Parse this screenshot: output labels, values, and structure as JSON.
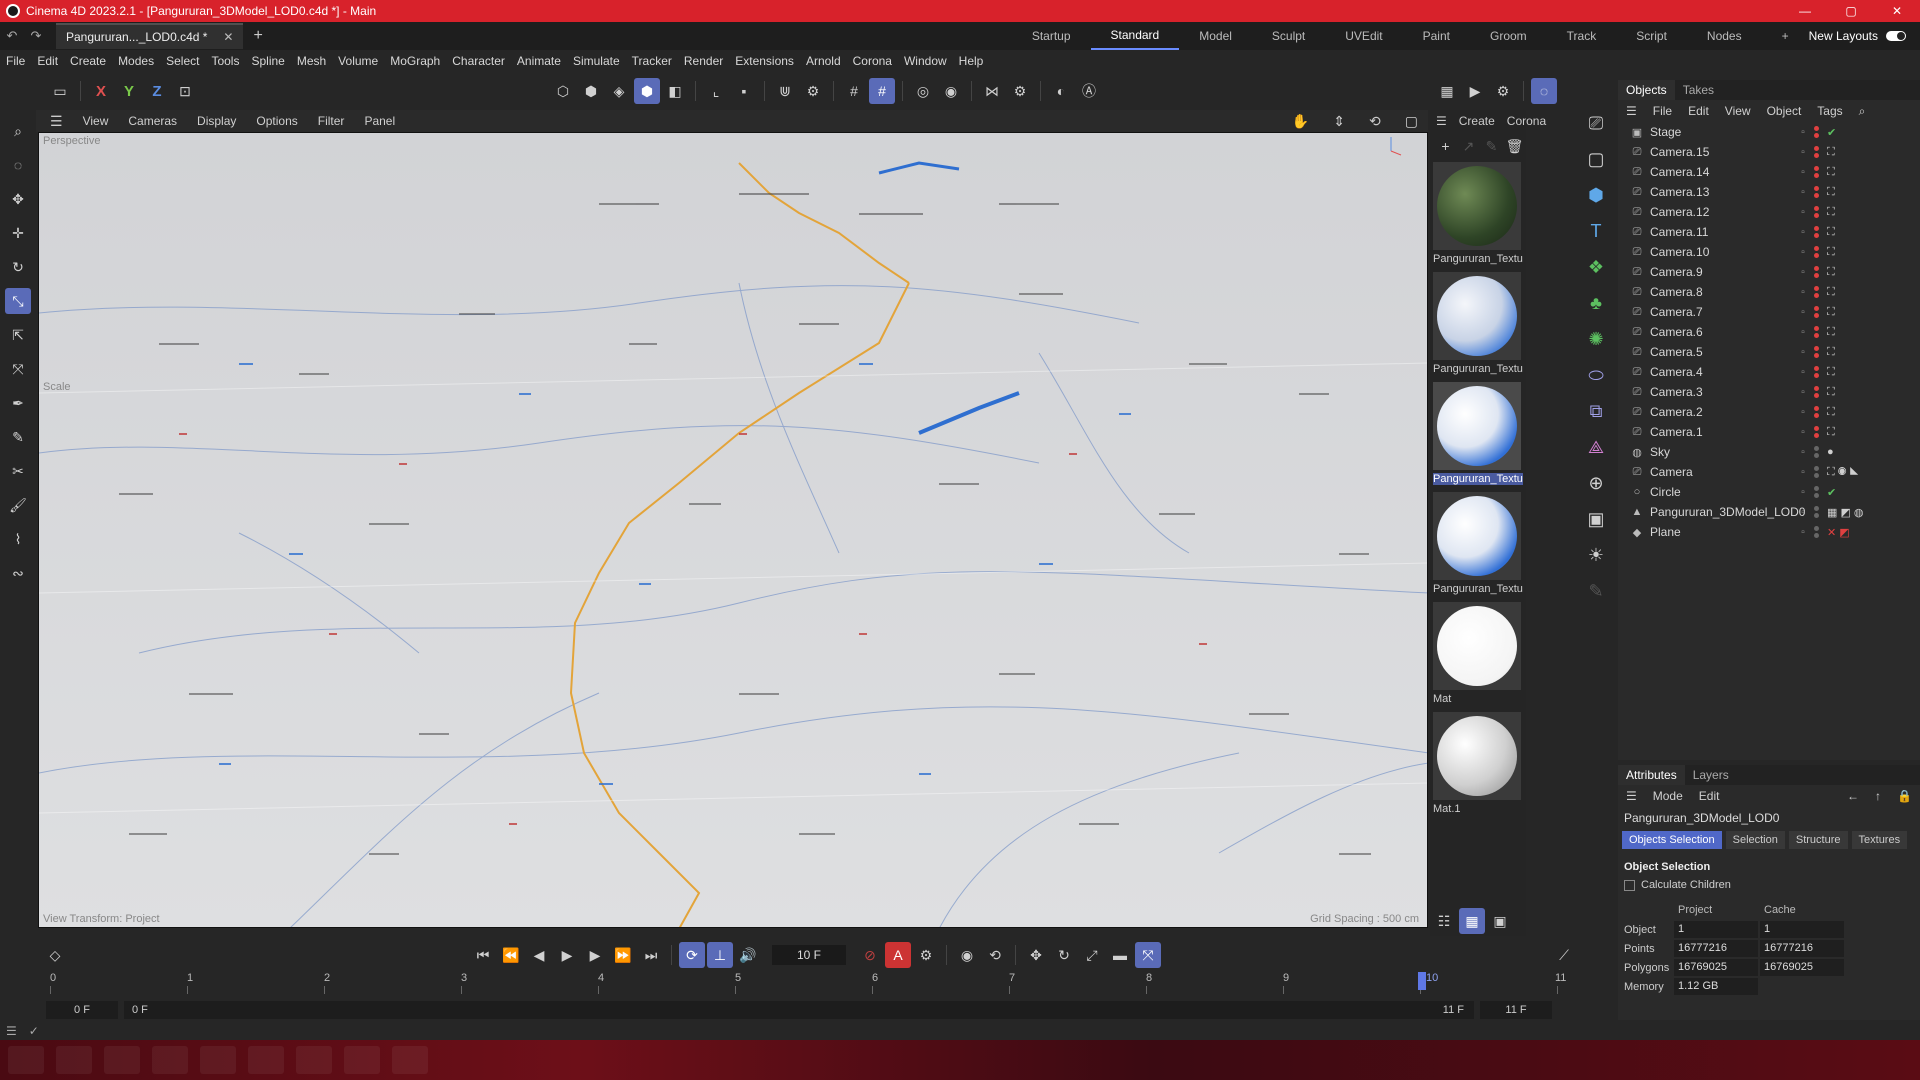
{
  "window": {
    "title": "Cinema 4D 2023.2.1 - [Pangururan_3DModel_LOD0.c4d *] - Main",
    "controls": [
      "—",
      "▢",
      "✕"
    ]
  },
  "doc_tab": {
    "label": "Pangururan..._LOD0.c4d *",
    "close": "✕",
    "add": "+"
  },
  "layouts": {
    "items": [
      "Startup",
      "Standard",
      "Model",
      "Sculpt",
      "UVEdit",
      "Paint",
      "Groom",
      "Track",
      "Script",
      "Nodes"
    ],
    "active": "Standard",
    "add": "+",
    "new_layouts": "New Layouts"
  },
  "menu": [
    "File",
    "Edit",
    "Create",
    "Modes",
    "Select",
    "Tools",
    "Spline",
    "Mesh",
    "Volume",
    "MoGraph",
    "Character",
    "Animate",
    "Simulate",
    "Tracker",
    "Render",
    "Extensions",
    "Arnold",
    "Corona",
    "Window",
    "Help"
  ],
  "toolbar": {
    "axes": [
      "X",
      "Y",
      "Z"
    ]
  },
  "viewport": {
    "menu": [
      "View",
      "Cameras",
      "Display",
      "Options",
      "Filter",
      "Panel"
    ],
    "camera_label": "Perspective",
    "tool_label": "Scale",
    "footer_left": "View Transform: Project",
    "footer_right": "Grid Spacing : 500 cm"
  },
  "materials": {
    "menu": [
      "Create",
      "Corona"
    ],
    "items": [
      {
        "label": "Pangururan_Textu",
        "kind": "terrain"
      },
      {
        "label": "Pangururan_Textu",
        "kind": "map"
      },
      {
        "label": "Pangururan_Textu",
        "kind": "map",
        "selected": true
      },
      {
        "label": "Pangururan_Textu",
        "kind": "map"
      },
      {
        "label": "Mat",
        "kind": "white"
      },
      {
        "label": "Mat.1",
        "kind": "grey"
      }
    ]
  },
  "objects_panel": {
    "tabs": [
      "Objects",
      "Takes"
    ],
    "menu": [
      "File",
      "Edit",
      "View",
      "Object",
      "Tags"
    ],
    "items": [
      {
        "name": "Stage",
        "icon": "▣",
        "tag": "✔"
      },
      {
        "name": "Camera.15",
        "icon": "⎚",
        "tag": "⛶"
      },
      {
        "name": "Camera.14",
        "icon": "⎚",
        "tag": "⛶"
      },
      {
        "name": "Camera.13",
        "icon": "⎚",
        "tag": "⛶"
      },
      {
        "name": "Camera.12",
        "icon": "⎚",
        "tag": "⛶"
      },
      {
        "name": "Camera.11",
        "icon": "⎚",
        "tag": "⛶"
      },
      {
        "name": "Camera.10",
        "icon": "⎚",
        "tag": "⛶"
      },
      {
        "name": "Camera.9",
        "icon": "⎚",
        "tag": "⛶"
      },
      {
        "name": "Camera.8",
        "icon": "⎚",
        "tag": "⛶"
      },
      {
        "name": "Camera.7",
        "icon": "⎚",
        "tag": "⛶"
      },
      {
        "name": "Camera.6",
        "icon": "⎚",
        "tag": "⛶"
      },
      {
        "name": "Camera.5",
        "icon": "⎚",
        "tag": "⛶"
      },
      {
        "name": "Camera.4",
        "icon": "⎚",
        "tag": "⛶"
      },
      {
        "name": "Camera.3",
        "icon": "⎚",
        "tag": "⛶"
      },
      {
        "name": "Camera.2",
        "icon": "⎚",
        "tag": "⛶"
      },
      {
        "name": "Camera.1",
        "icon": "⎚",
        "tag": "⛶"
      },
      {
        "name": "Sky",
        "icon": "◍",
        "tag": "●"
      },
      {
        "name": "Camera",
        "icon": "⎚",
        "tag": "⛶ ◉ ◣"
      },
      {
        "name": "Circle",
        "icon": "○",
        "tag": "✔"
      },
      {
        "name": "Pangururan_3DModel_LOD0",
        "icon": "▲",
        "tag": "▦ ◩ ◍"
      },
      {
        "name": "Plane",
        "icon": "◆",
        "tag": "✕ ◩"
      }
    ]
  },
  "attributes": {
    "tabs": [
      "Attributes",
      "Layers"
    ],
    "menu": [
      "Mode",
      "Edit"
    ],
    "object_name": "Pangururan_3DModel_LOD0",
    "subtabs": [
      "Objects Selection",
      "Selection",
      "Structure",
      "Textures"
    ],
    "active_subtab": "Objects Selection",
    "section": "Object Selection",
    "checkbox": "Calculate Children",
    "columns": [
      "Project",
      "Cache"
    ],
    "rows": [
      {
        "label": "Object",
        "project": "1",
        "cache": "1"
      },
      {
        "label": "Points",
        "project": "16777216",
        "cache": "16777216"
      },
      {
        "label": "Polygons",
        "project": "16769025",
        "cache": "16769025"
      },
      {
        "label": "Memory",
        "project": "1.12 GB",
        "cache": ""
      }
    ]
  },
  "timeline": {
    "current_frame": "10 F",
    "ticks": [
      "0",
      "1",
      "2",
      "3",
      "4",
      "5",
      "6",
      "7",
      "8",
      "9",
      "10",
      "11"
    ],
    "playhead_frame": 10,
    "range": {
      "start": "0 F",
      "min": "0 F",
      "max": "11 F",
      "end": "11 F"
    }
  }
}
